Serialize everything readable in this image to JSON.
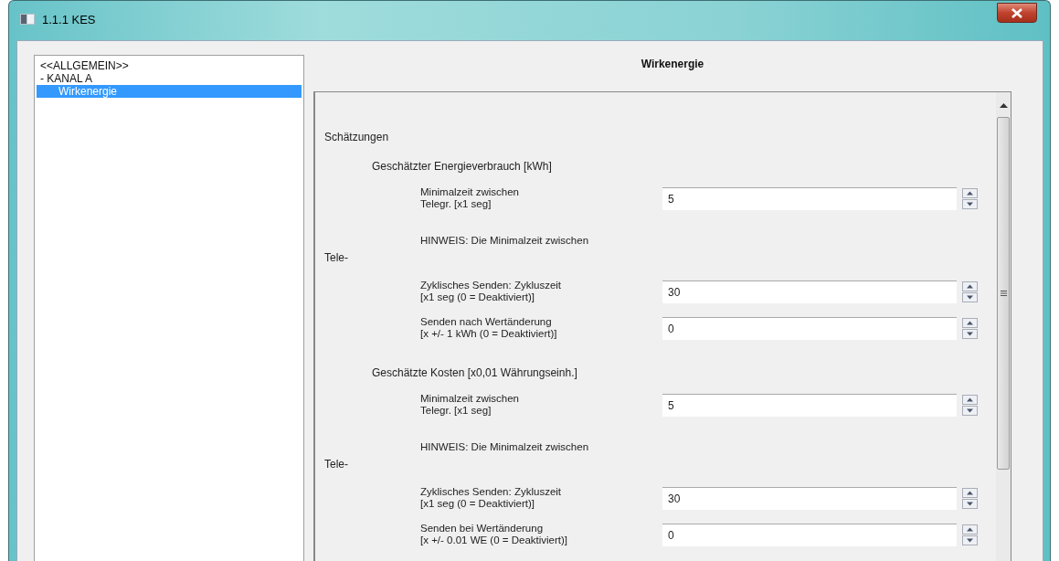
{
  "window": {
    "title": "1.1.1 KES"
  },
  "sidebar": {
    "items": [
      {
        "label": "<<ALLGEMEIN>>",
        "selected": false
      },
      {
        "label": "- KANAL A",
        "selected": false,
        "children": [
          {
            "label": "Wirkenergie",
            "selected": true
          }
        ]
      }
    ]
  },
  "panel": {
    "title": "Wirkenergie",
    "heading": "Schätzungen",
    "groups": [
      {
        "title": "Geschätzter Energieverbrauch [kWh]",
        "items": [
          {
            "kind": "spin",
            "label": "Minimalzeit zwischen\nTelegr. [x1 seg]",
            "value": "5"
          },
          {
            "kind": "note",
            "text": "HINWEIS: Die Minimalzeit zwischen",
            "continuation": "Tele-"
          },
          {
            "kind": "spin",
            "label": "Zyklisches Senden: Zykluszeit\n[x1 seg (0 = Deaktiviert)]",
            "value": "30"
          },
          {
            "kind": "spin",
            "label": "Senden nach Wertänderung\n[x +/- 1 kWh (0 = Deaktiviert)]",
            "value": "0"
          }
        ]
      },
      {
        "title": "Geschätzte Kosten [x0,01 Währungseinh.]",
        "items": [
          {
            "kind": "spin",
            "label": "Minimalzeit zwischen\nTelegr. [x1 seg]",
            "value": "5"
          },
          {
            "kind": "note",
            "text": "HINWEIS: Die Minimalzeit zwischen",
            "continuation": "Tele-"
          },
          {
            "kind": "spin",
            "label": "Zyklisches Senden: Zykluszeit\n[x1 seg (0 = Deaktiviert)]",
            "value": "30"
          },
          {
            "kind": "spin",
            "label": "Senden bei Wertänderung\n[x +/- 0.01 WE (0 = Deaktiviert)]",
            "value": "0"
          }
        ]
      }
    ]
  }
}
